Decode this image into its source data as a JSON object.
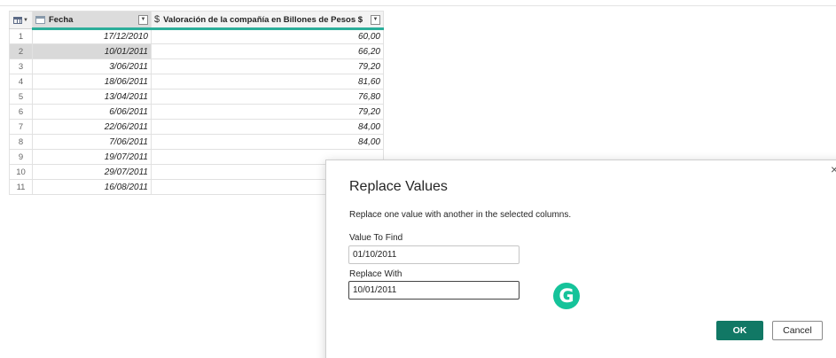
{
  "grid": {
    "columns": [
      {
        "name": "Fecha",
        "type_icon": "calendar-icon"
      },
      {
        "name": "Valoración de la compañía en Billones de Pesos $",
        "type_icon": "$"
      }
    ],
    "rows": [
      {
        "n": "1",
        "fecha": "17/12/2010",
        "valor": "60,00"
      },
      {
        "n": "2",
        "fecha": "10/01/2011",
        "valor": "66,20"
      },
      {
        "n": "3",
        "fecha": "3/06/2011",
        "valor": "79,20"
      },
      {
        "n": "4",
        "fecha": "18/06/2011",
        "valor": "81,60"
      },
      {
        "n": "5",
        "fecha": "13/04/2011",
        "valor": "76,80"
      },
      {
        "n": "6",
        "fecha": "6/06/2011",
        "valor": "79,20"
      },
      {
        "n": "7",
        "fecha": "22/06/2011",
        "valor": "84,00"
      },
      {
        "n": "8",
        "fecha": "7/06/2011",
        "valor": "84,00"
      },
      {
        "n": "9",
        "fecha": "19/07/2011",
        "valor": ""
      },
      {
        "n": "10",
        "fecha": "29/07/2011",
        "valor": ""
      },
      {
        "n": "11",
        "fecha": "16/08/2011",
        "valor": ""
      }
    ],
    "selected_row": 2
  },
  "dialog": {
    "title": "Replace Values",
    "description": "Replace one value with another in the selected columns.",
    "find_label": "Value To Find",
    "find_value": "01/10/2011",
    "replace_label": "Replace With",
    "replace_value": "10/01/2011",
    "ok_label": "OK",
    "cancel_label": "Cancel",
    "close_glyph": "×"
  },
  "grammarly_badge": "G",
  "colors": {
    "accent": "#117865",
    "header_underline": "#2cae9a",
    "grammarly": "#15c39a"
  }
}
